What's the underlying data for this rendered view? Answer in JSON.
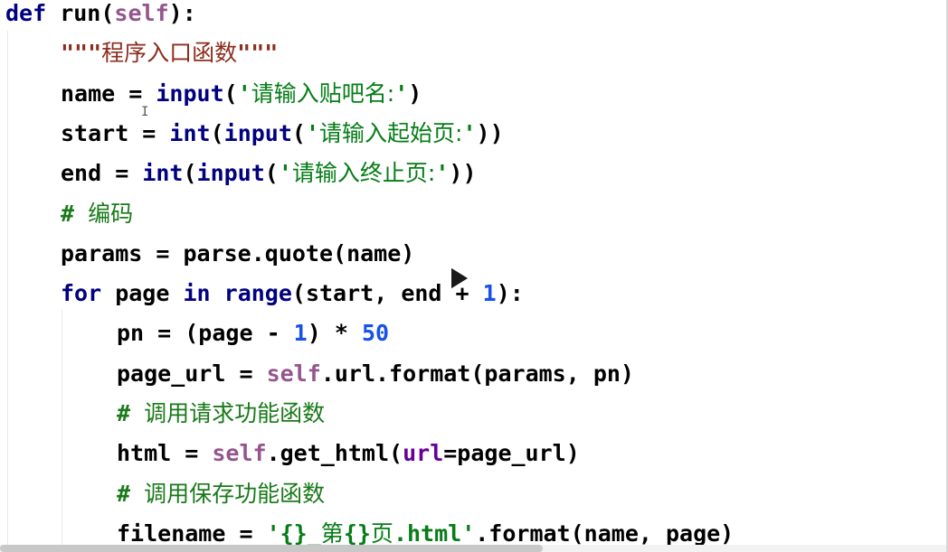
{
  "editor": {
    "language": "python",
    "lines": [
      {
        "indent": 0,
        "tokens": [
          {
            "t": "kw",
            "v": "def"
          },
          {
            "t": "plain",
            "v": " run("
          },
          {
            "t": "self",
            "v": "self"
          },
          {
            "t": "plain",
            "v": "):"
          }
        ]
      },
      {
        "indent": 1,
        "tokens": [
          {
            "t": "docq",
            "v": "\"\"\""
          },
          {
            "t": "doccjk",
            "v": "程序入口函数"
          },
          {
            "t": "docq",
            "v": "\"\"\""
          }
        ]
      },
      {
        "indent": 1,
        "tokens": [
          {
            "t": "plain",
            "v": "name = "
          },
          {
            "t": "builtin",
            "v": "input"
          },
          {
            "t": "plain",
            "v": "("
          },
          {
            "t": "str",
            "v": "'"
          },
          {
            "t": "strcjk",
            "v": "请输入贴吧名:"
          },
          {
            "t": "str",
            "v": "'"
          },
          {
            "t": "plain",
            "v": ")"
          }
        ]
      },
      {
        "indent": 1,
        "tokens": [
          {
            "t": "plain",
            "v": "start = "
          },
          {
            "t": "builtin",
            "v": "int"
          },
          {
            "t": "plain",
            "v": "("
          },
          {
            "t": "builtin",
            "v": "input"
          },
          {
            "t": "plain",
            "v": "("
          },
          {
            "t": "str",
            "v": "'"
          },
          {
            "t": "strcjk",
            "v": "请输入起始页:"
          },
          {
            "t": "str",
            "v": "'"
          },
          {
            "t": "plain",
            "v": "))"
          }
        ]
      },
      {
        "indent": 1,
        "tokens": [
          {
            "t": "plain",
            "v": "end = "
          },
          {
            "t": "builtin",
            "v": "int"
          },
          {
            "t": "plain",
            "v": "("
          },
          {
            "t": "builtin",
            "v": "input"
          },
          {
            "t": "plain",
            "v": "("
          },
          {
            "t": "str",
            "v": "'"
          },
          {
            "t": "strcjk",
            "v": "请输入终止页:"
          },
          {
            "t": "str",
            "v": "'"
          },
          {
            "t": "plain",
            "v": "))"
          }
        ]
      },
      {
        "indent": 1,
        "tokens": [
          {
            "t": "comment",
            "v": "# "
          },
          {
            "t": "cmcjk",
            "v": "编码"
          }
        ]
      },
      {
        "indent": 1,
        "tokens": [
          {
            "t": "plain",
            "v": "params = parse.quote(name)"
          }
        ]
      },
      {
        "indent": 1,
        "tokens": [
          {
            "t": "kw",
            "v": "for"
          },
          {
            "t": "plain",
            "v": " page "
          },
          {
            "t": "kw",
            "v": "in"
          },
          {
            "t": "plain",
            "v": " "
          },
          {
            "t": "builtin",
            "v": "range"
          },
          {
            "t": "plain",
            "v": "(start, end + "
          },
          {
            "t": "num",
            "v": "1"
          },
          {
            "t": "plain",
            "v": "):"
          }
        ]
      },
      {
        "indent": 2,
        "tokens": [
          {
            "t": "plain",
            "v": "pn = (page - "
          },
          {
            "t": "num",
            "v": "1"
          },
          {
            "t": "plain",
            "v": ") * "
          },
          {
            "t": "num",
            "v": "50"
          }
        ]
      },
      {
        "indent": 2,
        "tokens": [
          {
            "t": "plain",
            "v": "page_url = "
          },
          {
            "t": "self",
            "v": "self"
          },
          {
            "t": "plain",
            "v": ".url.format(params, pn)"
          }
        ]
      },
      {
        "indent": 2,
        "tokens": [
          {
            "t": "comment",
            "v": "# "
          },
          {
            "t": "cmcjk",
            "v": "调用请求功能函数"
          }
        ]
      },
      {
        "indent": 2,
        "tokens": [
          {
            "t": "plain",
            "v": "html = "
          },
          {
            "t": "self",
            "v": "self"
          },
          {
            "t": "plain",
            "v": ".get_html("
          },
          {
            "t": "param",
            "v": "url"
          },
          {
            "t": "plain",
            "v": "=page_url)"
          }
        ]
      },
      {
        "indent": 2,
        "tokens": [
          {
            "t": "comment",
            "v": "# "
          },
          {
            "t": "cmcjk",
            "v": "调用保存功能函数"
          }
        ]
      },
      {
        "indent": 2,
        "tokens": [
          {
            "t": "plain",
            "v": "filename = "
          },
          {
            "t": "str",
            "v": "'{}_"
          },
          {
            "t": "strcjk",
            "v": "第"
          },
          {
            "t": "str",
            "v": "{}"
          },
          {
            "t": "strcjk",
            "v": "页"
          },
          {
            "t": "str",
            "v": ".html'"
          },
          {
            "t": "plain",
            "v": ".format(name, page)"
          }
        ]
      }
    ]
  },
  "overlay": {
    "play_icon": "play-icon",
    "cursor_icon": "text-cursor-icon"
  },
  "colors": {
    "keyword": "#000080",
    "self": "#94558d",
    "string": "#067d17",
    "docstring": "#8c2e1e",
    "comment": "#1a7a1a",
    "number": "#1750eb",
    "param": "#660099"
  }
}
